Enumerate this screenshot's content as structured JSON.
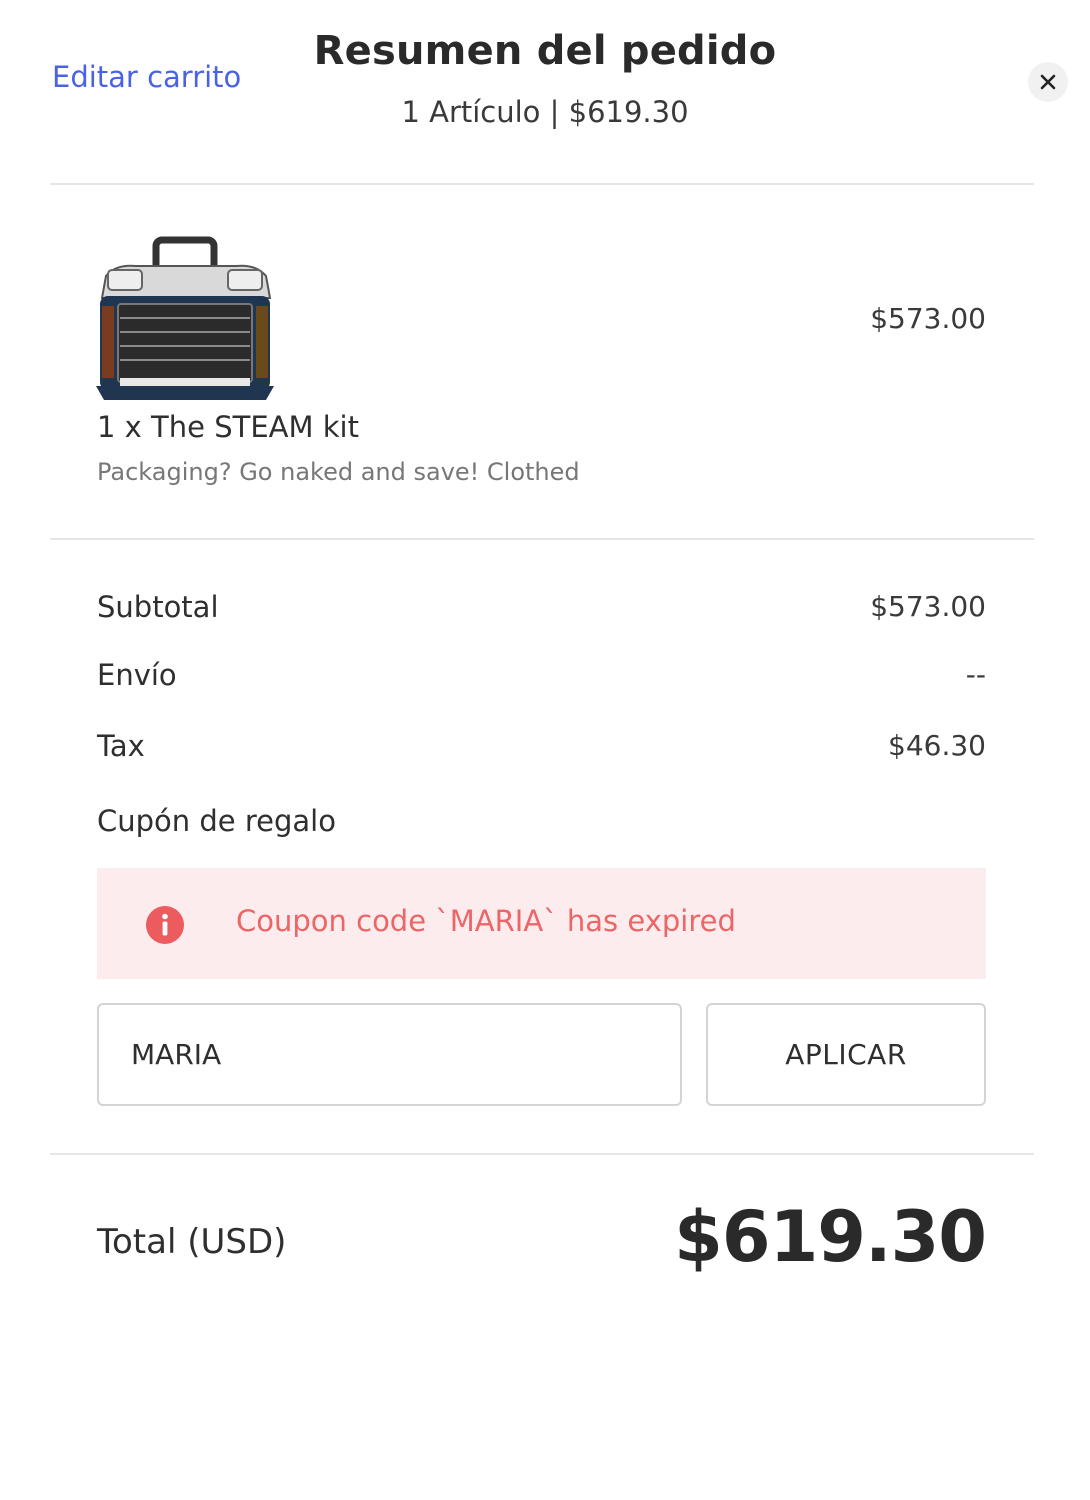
{
  "header": {
    "edit_cart_label": "Editar carrito",
    "title": "Resumen del pedido",
    "subtitle": "1 Artículo | $619.30",
    "close_icon": "close-icon"
  },
  "item": {
    "name": "1 x The STEAM kit",
    "option": "Packaging? Go naked and save! Clothed",
    "price": "$573.00",
    "image_icon": "toolbox-product-image"
  },
  "summary": {
    "subtotal_label": "Subtotal",
    "subtotal_value": "$573.00",
    "shipping_label": "Envío",
    "shipping_value": "--",
    "tax_label": "Tax",
    "tax_value": "$46.30",
    "coupon_label": "Cupón de regalo"
  },
  "coupon": {
    "error_message": "Coupon code `MARIA` has expired",
    "error_icon": "info-icon",
    "input_value": "MARIA",
    "apply_label": "APLICAR"
  },
  "total": {
    "label": "Total (USD)",
    "value": "$619.30"
  },
  "colors": {
    "link": "#4a63e6",
    "error_text": "#ec6567",
    "error_bg": "#fdeced"
  }
}
